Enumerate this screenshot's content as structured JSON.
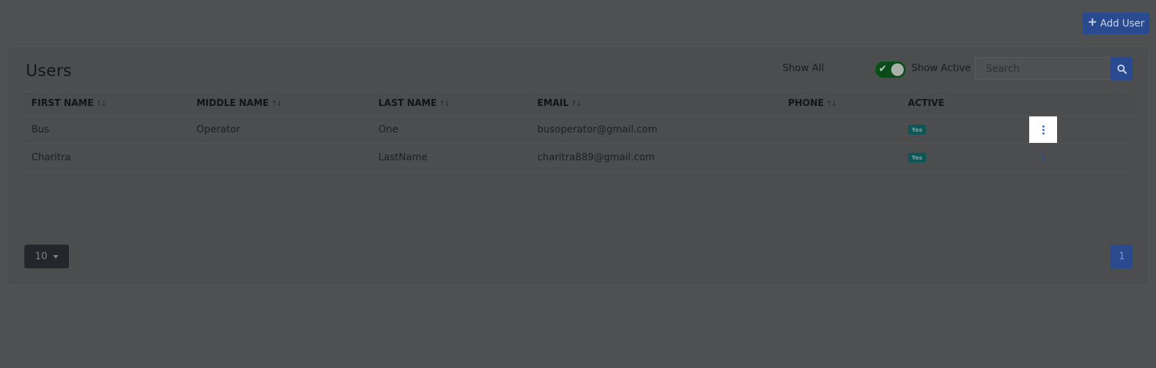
{
  "header": {
    "add_user_icon": "plus-icon",
    "add_user_label": "Add User"
  },
  "card": {
    "title": "Users",
    "filter": {
      "show_all_label": "Show All",
      "show_active_label": "Show Active",
      "toggle_on": true
    },
    "search": {
      "placeholder": "Search",
      "value": "",
      "icon": "search-icon"
    },
    "table": {
      "columns": [
        {
          "label": "FIRST NAME",
          "sortable": true
        },
        {
          "label": "MIDDLE NAME",
          "sortable": true
        },
        {
          "label": "LAST NAME",
          "sortable": true
        },
        {
          "label": "EMAIL",
          "sortable": true
        },
        {
          "label": "PHONE",
          "sortable": true
        },
        {
          "label": "ACTIVE",
          "sortable": false
        }
      ],
      "sort_icon": "sort-arrows-icon",
      "rows": [
        {
          "first_name": "Bus",
          "middle_name": "Operator",
          "last_name": "One",
          "email": "busoperator@gmail.com",
          "phone": "",
          "active": "Yes"
        },
        {
          "first_name": "Charitra",
          "middle_name": "",
          "last_name": "LastName",
          "email": "charitra889@gmail.com",
          "phone": "",
          "active": "Yes"
        }
      ]
    },
    "pagination": {
      "page_size": "10",
      "current_page": "1"
    }
  },
  "colors": {
    "primary": "#2a4a8f",
    "toggle_on": "#0c4a19",
    "badge": "#0e5557",
    "overlay_bg": "#4f5052"
  }
}
